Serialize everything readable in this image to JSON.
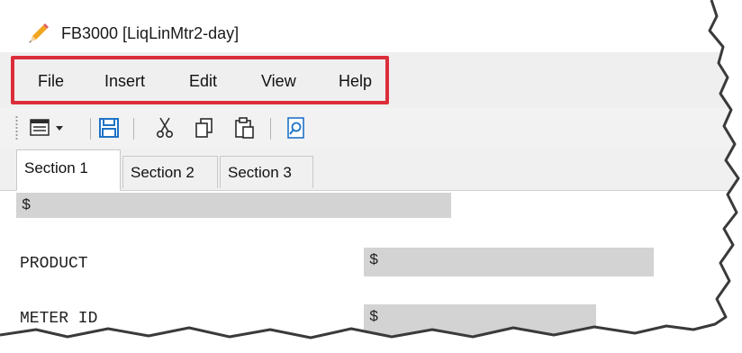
{
  "window": {
    "title": "FB3000 [LiqLinMtr2-day]",
    "app_icon": "pencil-icon"
  },
  "menu": {
    "items": [
      "File",
      "Insert",
      "Edit",
      "View",
      "Help"
    ],
    "highlight_color": "#dc2e3a"
  },
  "toolbar": {
    "buttons": [
      "layout-dropdown-icon",
      "save-icon",
      "cut-icon",
      "copy-icon",
      "paste-icon",
      "preview-icon"
    ]
  },
  "tabs": {
    "items": [
      "Section 1",
      "Section 2",
      "Section 3"
    ],
    "active": "Section 1"
  },
  "form": {
    "top_field_value": "$",
    "rows": [
      {
        "label": "PRODUCT",
        "value": "$"
      },
      {
        "label": "METER ID",
        "value": "$"
      }
    ]
  },
  "colors": {
    "field_background": "#d3d3d3",
    "menubar_background": "#efefef",
    "save_icon": "#1f73c7"
  }
}
